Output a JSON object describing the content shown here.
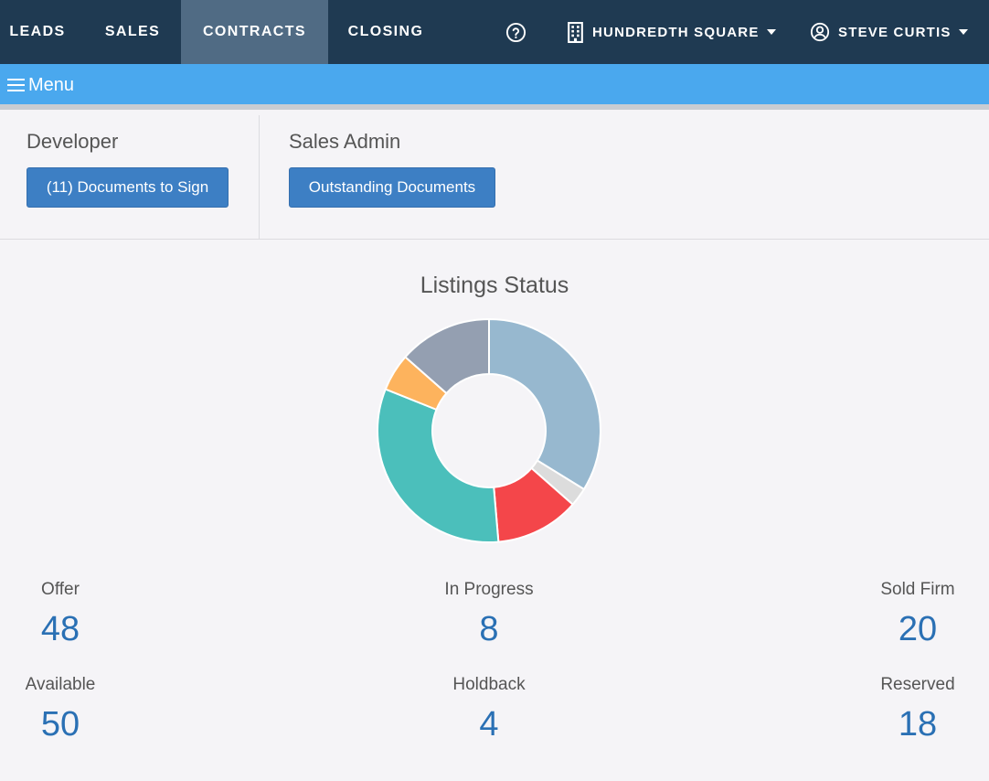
{
  "nav": {
    "tabs": [
      {
        "label": "LEADS"
      },
      {
        "label": "SALES"
      },
      {
        "label": "CONTRACTS",
        "active": true
      },
      {
        "label": "CLOSING"
      }
    ],
    "help_icon": "question-circle-icon",
    "project": {
      "label": "HUNDREDTH SQUARE",
      "icon": "building-icon"
    },
    "user": {
      "label": "STEVE CURTIS",
      "icon": "user-circle-icon"
    }
  },
  "menubar": {
    "label": "Menu",
    "icon": "hamburger-icon"
  },
  "developer": {
    "title": "Developer",
    "button": "(11) Documents to Sign"
  },
  "sales_admin": {
    "title": "Sales Admin",
    "button": "Outstanding Documents"
  },
  "chart_data": {
    "type": "pie",
    "title": "Listings Status",
    "style": "donut",
    "categories": [
      "Available",
      "Holdback",
      "Reserved",
      "Offer",
      "In Progress",
      "Sold Firm"
    ],
    "values": [
      50,
      4,
      18,
      48,
      8,
      20
    ],
    "colors": [
      "#97b8cf",
      "#dcdcdc",
      "#f4464a",
      "#4bbfbb",
      "#fdb35d",
      "#949fb1"
    ]
  },
  "stats": [
    {
      "label": "Offer",
      "value": "48"
    },
    {
      "label": "In Progress",
      "value": "8"
    },
    {
      "label": "Sold Firm",
      "value": "20"
    },
    {
      "label": "Available",
      "value": "50"
    },
    {
      "label": "Holdback",
      "value": "4"
    },
    {
      "label": "Reserved",
      "value": "18"
    }
  ]
}
